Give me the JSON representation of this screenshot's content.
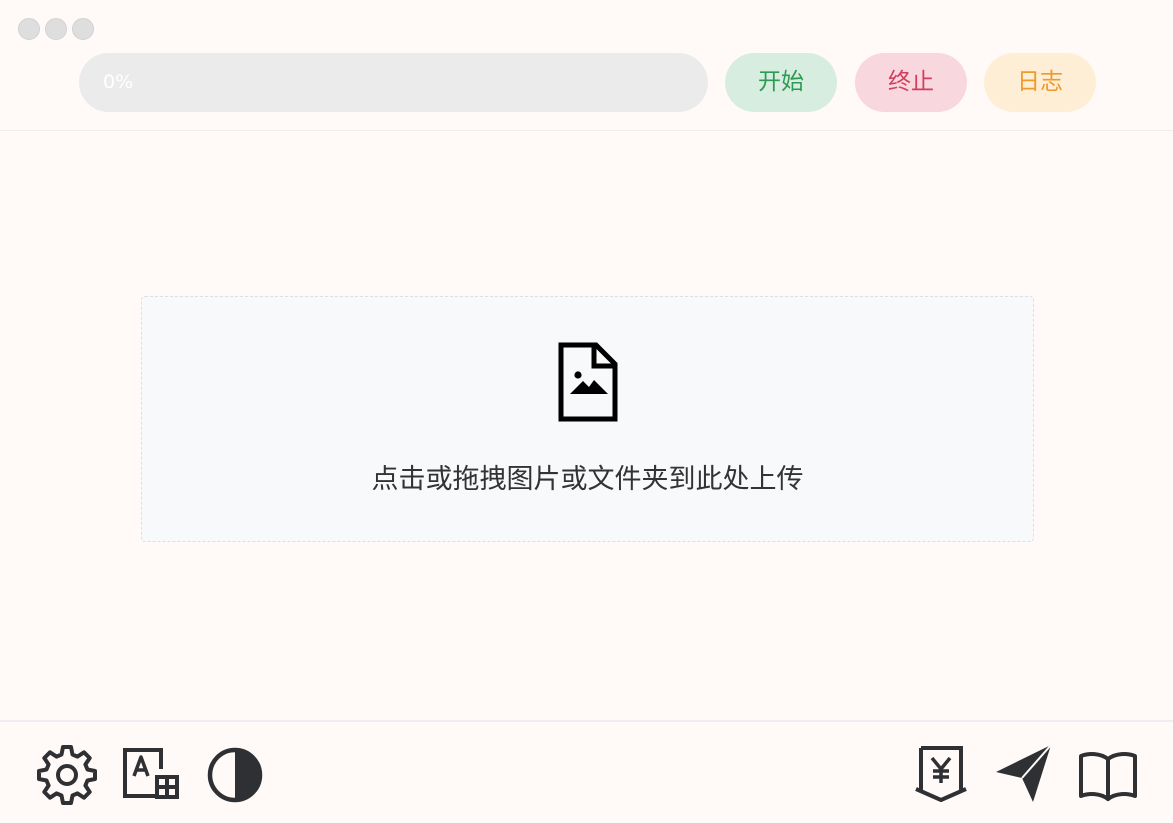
{
  "window": {
    "traffic_lights": [
      "close",
      "minimize",
      "maximize"
    ]
  },
  "header": {
    "progress": {
      "value": 0,
      "label": "0%"
    },
    "buttons": {
      "start_label": "开始",
      "stop_label": "终止",
      "log_label": "日志"
    }
  },
  "dropzone": {
    "icon": "file-image-icon",
    "text": "点击或拖拽图片或文件夹到此处上传"
  },
  "footer": {
    "left_icons": [
      "gear-icon",
      "font-add-icon",
      "contrast-icon"
    ],
    "right_icons": [
      "yen-shield-icon",
      "send-icon",
      "book-icon"
    ]
  },
  "colors": {
    "background": "#fffaf8",
    "start": "#2f9a54",
    "stop": "#d23f5e",
    "log": "#ef9a2a"
  }
}
